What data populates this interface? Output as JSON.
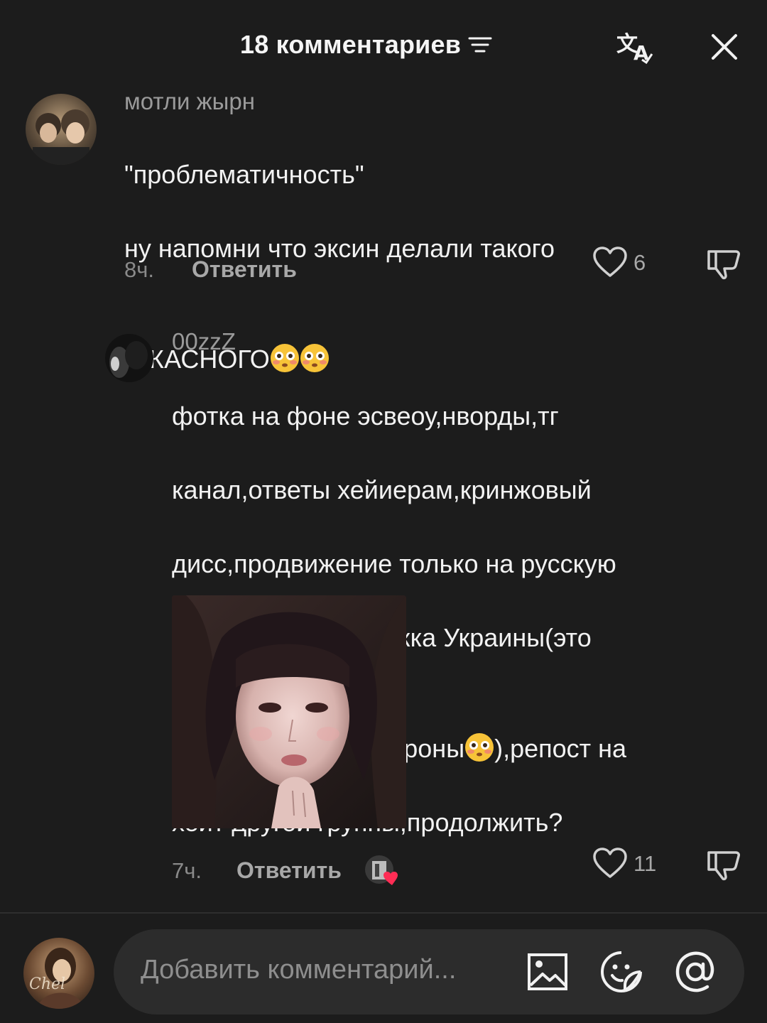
{
  "header": {
    "title": "18 комментариев",
    "sort_icon": "sort-lines-icon",
    "translate_icon": "translate-icon",
    "close_icon": "close-icon"
  },
  "comments": [
    {
      "username": "мотли жырн",
      "text_lines": [
        "\"проблематичность\"",
        "ну напомни что эксин делали такого",
        "УЖАСНОГО"
      ],
      "emojis": [
        "flushed-face",
        "flushed-face"
      ],
      "time": "8ч.",
      "reply_label": "Ответить",
      "likes": "6"
    },
    {
      "username": "00zzZ",
      "text_lines": [
        "фотка на фоне эсвеоу,нворды,тг",
        "канал,ответы хейиерам,кринжовый",
        "дисс,продвижение только на русскую",
        "аудиторию,поддержка Украины(это",
        "лицемерно с их стороны",
        "),репост на",
        "хейт другой группы,продолжить?"
      ],
      "emojis": [
        "flushed-face"
      ],
      "time": "7ч.",
      "reply_label": "Ответить",
      "likes": "11"
    }
  ],
  "composer": {
    "placeholder": "Добавить комментарий...",
    "image_icon": "image-icon",
    "sticker_icon": "sticker-icon",
    "mention_icon": "at-mention-icon"
  },
  "colors": {
    "background": "#1c1c1c",
    "input_background": "#2c2c2c",
    "text_primary": "#f2f2f2",
    "text_secondary": "#9a9a9a"
  }
}
